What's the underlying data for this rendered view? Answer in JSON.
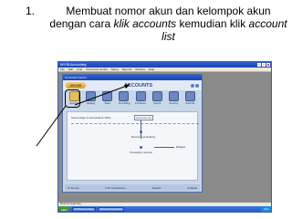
{
  "instruction": {
    "number": "1.",
    "text_before": "Membuat nomor akun dan kelompok akun dengan cara ",
    "emphasis_1": "klik accounts",
    "text_middle": " kemudian klik ",
    "emphasis_2": "account list"
  },
  "app": {
    "title": "MYOB Accounting",
    "menu": [
      "File",
      "Edit",
      "Lists",
      "Command Centre",
      "Setup",
      "Reports",
      "Window",
      "Help"
    ],
    "status": "Press F1 to get help"
  },
  "command_centre": {
    "title": "Command Centre",
    "logo": "MYOB",
    "heading": "ACCOUNTS",
    "modules": [
      "Accounts",
      "Banking",
      "Sales",
      "Time Billing",
      "Purchases",
      "Payroll",
      "Inventory",
      "Card File"
    ],
    "flow": {
      "send_label": "Send Ledger to Accountant's Office",
      "account_list": "Accounts List",
      "record_journal": "Record Journal Entry",
      "transaction_journal": "Transaction Journal",
      "budgets": "Budgets"
    },
    "footer": [
      "To Do List",
      "Find Transactions",
      "Reports",
      "Analysis"
    ]
  },
  "taskbar": {
    "start": "start",
    "tasks": [
      "MYOB Accounting",
      "Microsoft PowerPoint"
    ],
    "clock": "9:24"
  }
}
